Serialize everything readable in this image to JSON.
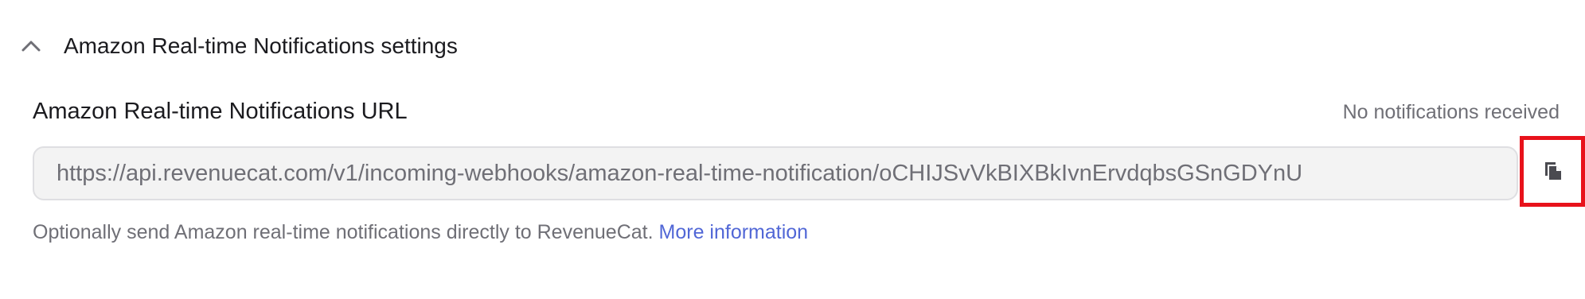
{
  "section": {
    "title": "Amazon Real-time Notifications settings",
    "toggle_icon": "chevron-up-icon"
  },
  "field": {
    "label": "Amazon Real-time Notifications URL",
    "status": "No notifications received",
    "value": "https://api.revenuecat.com/v1/incoming-webhooks/amazon-real-time-notification/oCHIJSvVkBIXBkIvnErvdqbsGSnGDYnU"
  },
  "copy_button": {
    "icon": "copy-icon",
    "highlight_color": "#e8121b"
  },
  "help": {
    "text": "Optionally send Amazon real-time notifications directly to RevenueCat.",
    "link_label": "More information",
    "link_color": "#5167d6"
  }
}
